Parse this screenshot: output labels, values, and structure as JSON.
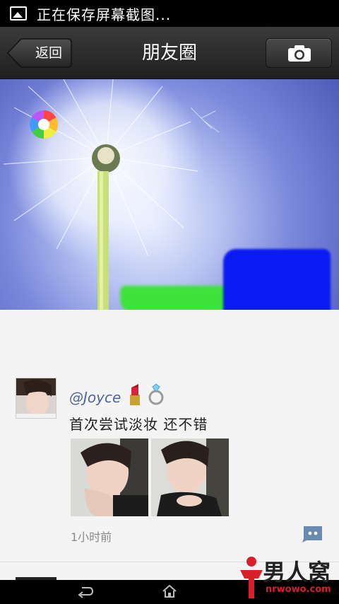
{
  "status_bar": {
    "text": "正在保存屏幕截图...",
    "icon": "image-icon"
  },
  "title_bar": {
    "back_label": "返回",
    "title": "朋友圈",
    "camera_icon": "camera-icon"
  },
  "cover": {
    "icon": "album-cover-icon"
  },
  "post": {
    "author": "@Joyce",
    "emojis": [
      "lipstick-emoji",
      "ring-emoji"
    ],
    "text": "首次尝试淡妆 还不错",
    "photos": [
      "photo-1",
      "photo-2"
    ],
    "time": "1小时前",
    "comment_icon": "comment-icon"
  },
  "nav_bar": {
    "back_icon": "back-icon",
    "home_icon": "home-icon"
  },
  "watermark": {
    "title": "男人窝",
    "url": "nrwowo.com"
  },
  "colors": {
    "accent_name": "#4f6796",
    "redaction_green": "#3fe23a",
    "redaction_blue": "#0a1af2"
  }
}
